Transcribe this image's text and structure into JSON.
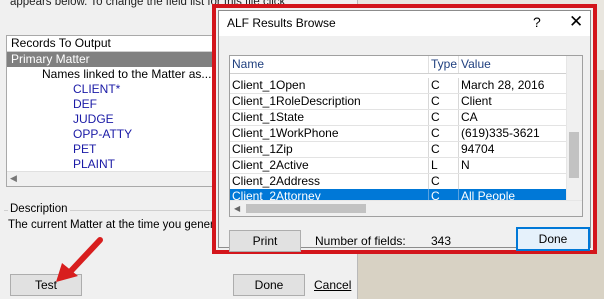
{
  "background_dialog": {
    "top_text": "appears below.  To change the field list for this file click",
    "records_header": "Records To Output",
    "records": [
      {
        "label": "Primary Matter",
        "level": "selected"
      },
      {
        "label": "Names linked to the Matter as...",
        "level": "1"
      },
      {
        "label": "CLIENT*",
        "level": "2"
      },
      {
        "label": "DEF",
        "level": "2"
      },
      {
        "label": "JUDGE",
        "level": "2"
      },
      {
        "label": "OPP-ATTY",
        "level": "2"
      },
      {
        "label": "PET",
        "level": "2"
      },
      {
        "label": "PLAINT",
        "level": "2"
      }
    ],
    "description_label": "Description",
    "description_text": "The current Matter at the time you generat",
    "test_button": "Test",
    "done_button": "Done",
    "cancel_link": "Cancel"
  },
  "popup": {
    "title": "ALF Results Browse",
    "help_icon": "question-mark",
    "close_icon": "x",
    "columns": [
      "Name",
      "Type",
      "Value"
    ],
    "rows": [
      {
        "name": "Client_1Open",
        "type": "C",
        "value": "March 28, 2016"
      },
      {
        "name": "Client_1RoleDescription",
        "type": "C",
        "value": "Client"
      },
      {
        "name": "Client_1State",
        "type": "C",
        "value": "CA"
      },
      {
        "name": "Client_1WorkPhone",
        "type": "C",
        "value": "(619)335-3621"
      },
      {
        "name": "Client_1Zip",
        "type": "C",
        "value": "94704"
      },
      {
        "name": "Client_2Active",
        "type": "L",
        "value": "N"
      },
      {
        "name": "Client_2Address",
        "type": "C",
        "value": ""
      },
      {
        "name": "Client_2Attorney",
        "type": "C",
        "value": "All People"
      }
    ],
    "selected_row": 7,
    "print_button": "Print",
    "num_fields_label": "Number of fields:",
    "num_fields_value": "343",
    "done_button": "Done"
  },
  "colors": {
    "highlight": "#d3151b",
    "selection": "#0078d7",
    "tree_selection": "#808080",
    "arrow": "#d81e1e"
  }
}
